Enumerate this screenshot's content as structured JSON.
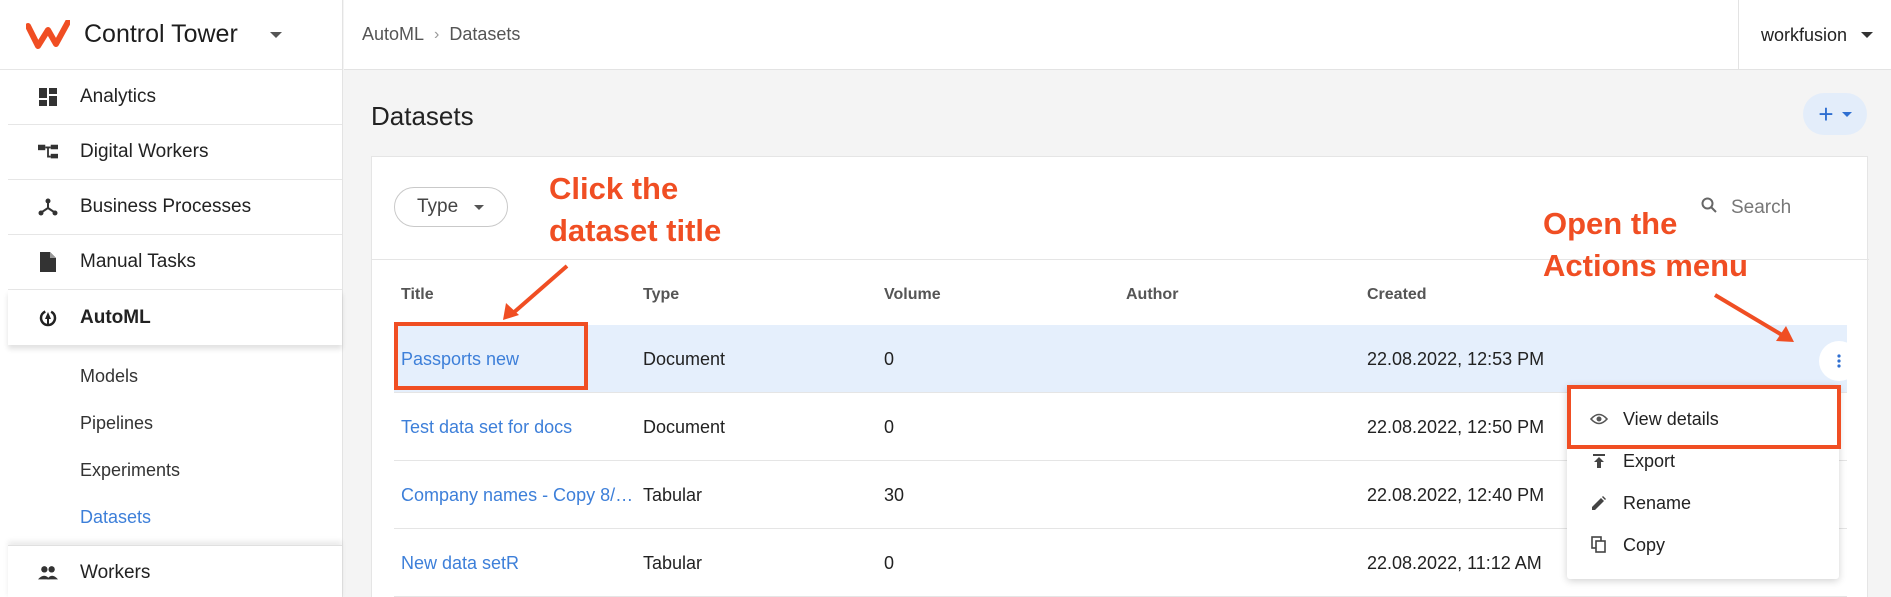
{
  "app": {
    "title": "Control Tower"
  },
  "sidebar": {
    "items": [
      {
        "label": "Analytics",
        "icon": "dashboard-icon"
      },
      {
        "label": "Digital Workers",
        "icon": "hierarchy-icon"
      },
      {
        "label": "Business Processes",
        "icon": "process-icon"
      },
      {
        "label": "Manual Tasks",
        "icon": "document-icon"
      },
      {
        "label": "AutoML",
        "icon": "automl-icon"
      }
    ],
    "subitems": [
      "Models",
      "Pipelines",
      "Experiments",
      "Datasets"
    ],
    "workers_label": "Workers"
  },
  "breadcrumb": {
    "root": "AutoML",
    "current": "Datasets"
  },
  "account": {
    "name": "workfusion"
  },
  "page": {
    "title": "Datasets",
    "add_label": "+"
  },
  "filters": {
    "type_label": "Type",
    "search_placeholder": "Search"
  },
  "table": {
    "headers": [
      "Title",
      "Type",
      "Volume",
      "Author",
      "Created"
    ],
    "rows": [
      {
        "title": "Passports new",
        "type": "Document",
        "volume": "0",
        "author": "",
        "created": "22.08.2022, 12:53 PM"
      },
      {
        "title": "Test data set for docs",
        "type": "Document",
        "volume": "0",
        "author": "",
        "created": "22.08.2022, 12:50 PM"
      },
      {
        "title": "Company names - Copy 8/…",
        "type": "Tabular",
        "volume": "30",
        "author": "",
        "created": "22.08.2022, 12:40 PM"
      },
      {
        "title": "New data setR",
        "type": "Tabular",
        "volume": "0",
        "author": "",
        "created": "22.08.2022, 11:12 AM"
      }
    ]
  },
  "actions_menu": {
    "items": [
      {
        "label": "View details",
        "icon": "eye-icon"
      },
      {
        "label": "Export",
        "icon": "upload-icon"
      },
      {
        "label": "Rename",
        "icon": "pencil-icon"
      },
      {
        "label": "Copy",
        "icon": "copy-icon"
      }
    ]
  },
  "annotations": {
    "click_title": [
      "Click the",
      "dataset title"
    ],
    "open_actions": [
      "Open the",
      "Actions menu"
    ]
  },
  "colors": {
    "accent": "#f04e23",
    "link": "#3d7fd9",
    "selected_row": "#e5effc"
  }
}
